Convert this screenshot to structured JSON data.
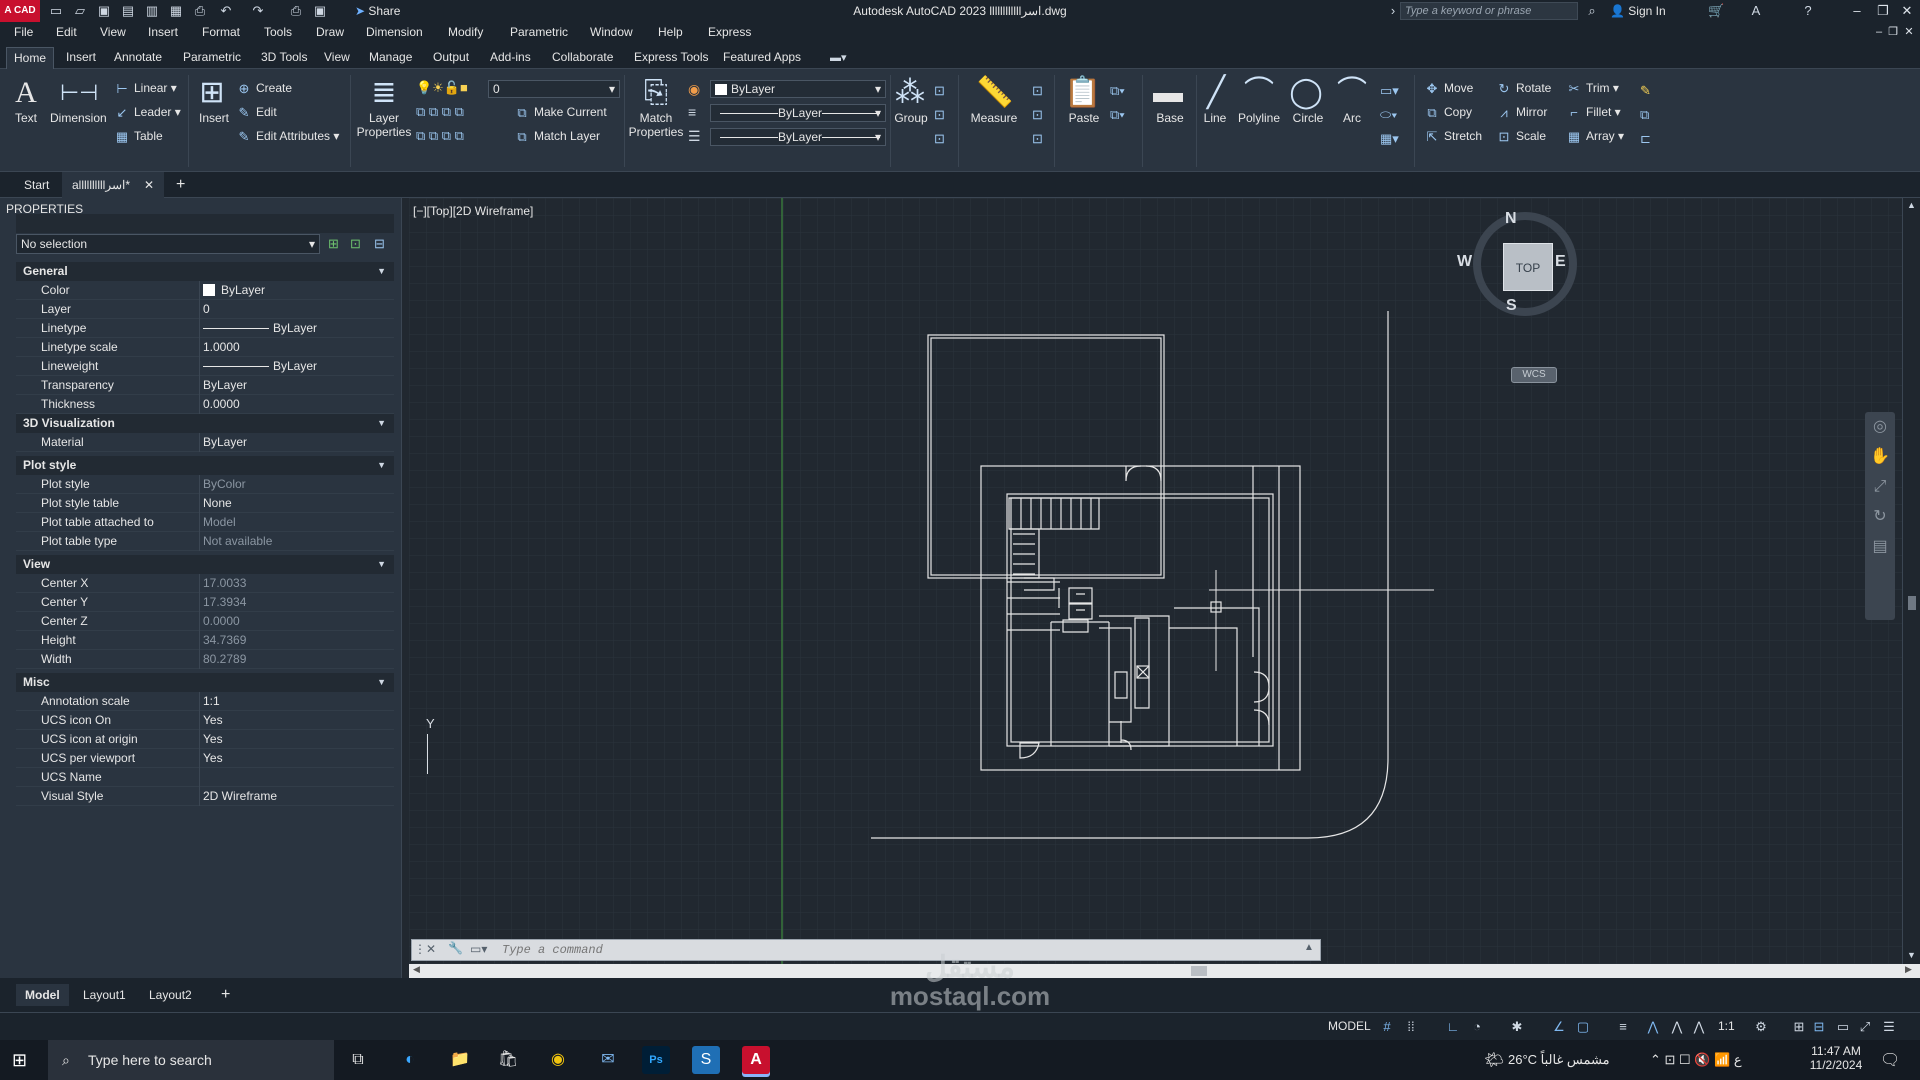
{
  "titlebar": {
    "app_logo": "A CAD",
    "title": "Autodesk AutoCAD 2023    llllllllllllاسر.dwg",
    "share": "Share",
    "search_placeholder": "Type a keyword or phrase",
    "sign_in": "Sign In"
  },
  "menu": [
    "File",
    "Edit",
    "View",
    "Insert",
    "Format",
    "Tools",
    "Draw",
    "Dimension",
    "Modify",
    "Parametric",
    "Window",
    "Help",
    "Express"
  ],
  "ribbon_tabs": [
    "Home",
    "Insert",
    "Annotate",
    "Parametric",
    "3D Tools",
    "View",
    "Manage",
    "Output",
    "Add-ins",
    "Collaborate",
    "Express Tools",
    "Featured Apps"
  ],
  "ribbon": {
    "text": "Text",
    "dimension": "Dimension",
    "linear": "Linear",
    "leader": "Leader",
    "table": "Table",
    "insert": "Insert",
    "create": "Create",
    "edit": "Edit",
    "edit_attributes": "Edit Attributes",
    "layer_properties": "Layer\nProperties",
    "layer_value": "0",
    "make_current": "Make Current",
    "match_layer": "Match Layer",
    "match_properties": "Match\nProperties",
    "color_value": "ByLayer",
    "linetype_value": "ByLayer",
    "lineweight_value": "ByLayer",
    "group": "Group",
    "measure": "Measure",
    "paste": "Paste",
    "base": "Base",
    "line": "Line",
    "polyline": "Polyline",
    "circle": "Circle",
    "arc": "Arc",
    "move": "Move",
    "rotate": "Rotate",
    "trim": "Trim",
    "copy": "Copy",
    "mirror": "Mirror",
    "fillet": "Fillet",
    "stretch": "Stretch",
    "scale": "Scale",
    "array": "Array"
  },
  "file_tabs": {
    "start": "Start",
    "drawing": "allllllllllاسر*"
  },
  "properties": {
    "title": "PROPERTIES",
    "selection": "No selection",
    "sections": [
      {
        "name": "General",
        "rows": [
          {
            "label": "Color",
            "value": "ByLayer"
          },
          {
            "label": "Layer",
            "value": "0"
          },
          {
            "label": "Linetype",
            "value": "ByLayer"
          },
          {
            "label": "Linetype scale",
            "value": "1.0000"
          },
          {
            "label": "Lineweight",
            "value": "ByLayer"
          },
          {
            "label": "Transparency",
            "value": "ByLayer"
          },
          {
            "label": "Thickness",
            "value": "0.0000"
          }
        ]
      },
      {
        "name": "3D Visualization",
        "rows": [
          {
            "label": "Material",
            "value": "ByLayer"
          }
        ]
      },
      {
        "name": "Plot style",
        "rows": [
          {
            "label": "Plot style",
            "value": "ByColor"
          },
          {
            "label": "Plot style table",
            "value": "None"
          },
          {
            "label": "Plot table attached to",
            "value": "Model"
          },
          {
            "label": "Plot table type",
            "value": "Not available"
          }
        ]
      },
      {
        "name": "View",
        "rows": [
          {
            "label": "Center X",
            "value": "17.0033"
          },
          {
            "label": "Center Y",
            "value": "17.3934"
          },
          {
            "label": "Center Z",
            "value": "0.0000"
          },
          {
            "label": "Height",
            "value": "34.7369"
          },
          {
            "label": "Width",
            "value": "80.2789"
          }
        ]
      },
      {
        "name": "Misc",
        "rows": [
          {
            "label": "Annotation scale",
            "value": "1:1"
          },
          {
            "label": "UCS icon On",
            "value": "Yes"
          },
          {
            "label": "UCS icon at origin",
            "value": "Yes"
          },
          {
            "label": "UCS per viewport",
            "value": "Yes"
          },
          {
            "label": "UCS Name",
            "value": ""
          },
          {
            "label": "Visual Style",
            "value": "2D Wireframe"
          }
        ]
      }
    ]
  },
  "viewport": {
    "label": "[−][Top][2D Wireframe]",
    "viewcube_top": "TOP",
    "compass_n": "N",
    "compass_s": "S",
    "compass_e": "E",
    "compass_w": "W",
    "wcs": "WCS",
    "ucs_y": "Y"
  },
  "command": {
    "placeholder": "Type a command"
  },
  "layout_tabs": [
    "Model",
    "Layout1",
    "Layout2"
  ],
  "status": {
    "model": "MODEL",
    "scale": "1:1"
  },
  "taskbar": {
    "search": "Type here to search",
    "weather": "26°C  مشمس غالباً",
    "time": "11:47 AM",
    "date": "11/2/2024"
  },
  "watermark": {
    "line1": "مستقل",
    "line2": "mostaql.com"
  }
}
